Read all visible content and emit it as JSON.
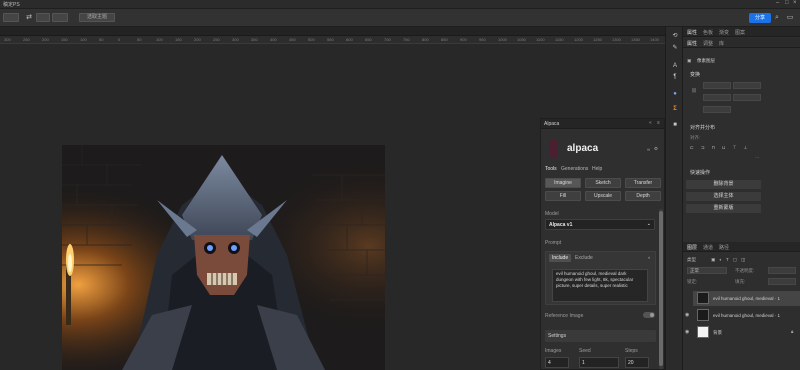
{
  "app": {
    "title": "稿定PS"
  },
  "options_bar": {
    "button_label": "选取主题",
    "share_label": "分享"
  },
  "ruler": {
    "ticks": [
      "300",
      "250",
      "200",
      "150",
      "100",
      "50",
      "0",
      "50",
      "100",
      "150",
      "200",
      "250",
      "300",
      "350",
      "400",
      "450",
      "500",
      "550",
      "600",
      "650",
      "700",
      "750",
      "800",
      "850",
      "900",
      "950",
      "1000",
      "1050",
      "1100",
      "1150",
      "1200",
      "1250",
      "1300",
      "1350",
      "1400"
    ]
  },
  "right_panel": {
    "tabs": [
      "属性",
      "色板",
      "渐变",
      "图案"
    ],
    "sub_tabs": [
      "属性",
      "调整",
      "库"
    ],
    "layer_title": "像素图层",
    "transform_title": "变换",
    "align_title": "对齐并分布",
    "align_label": "对齐:",
    "quick_title": "快速操作",
    "quick_actions": [
      "删除背景",
      "选择主体",
      "重新蒙版"
    ],
    "layers_tabs": [
      "图层",
      "通道",
      "路径"
    ],
    "kind_label": "类型",
    "blend_mode": "正常",
    "opacity_label": "不透明度:",
    "lock_label": "锁定:",
    "fill_label": "填充:",
    "layers": [
      {
        "name": "evil humanoid ghoul, medieval · 1",
        "selected": true
      },
      {
        "name": "evil humanoid ghoul, medieval · 1",
        "selected": false
      },
      {
        "name": "背景",
        "selected": false
      }
    ]
  },
  "alpaca": {
    "panel_title": "Alpaca",
    "brand": "alpaca",
    "nav": [
      "Tools",
      "Generations",
      "Help"
    ],
    "tools": [
      "Imagine",
      "Sketch",
      "Transfer",
      "Fill",
      "Upscale",
      "Depth"
    ],
    "model_label": "Model",
    "model_value": "Alpaca v1",
    "prompt_label": "Prompt",
    "prompt_tabs": [
      "Include",
      "Exclude"
    ],
    "prompt_text": "evil humanoid ghoul, medieval dark dungeon with few light, 8k, spectacular picture, super details, super realistic",
    "ref_label": "Reference Image",
    "settings_label": "Settings",
    "images_label": "Images",
    "images_value": "4",
    "seed_label": "Seed",
    "seed_value": "1",
    "steps_label": "Steps",
    "steps_value": "20"
  }
}
